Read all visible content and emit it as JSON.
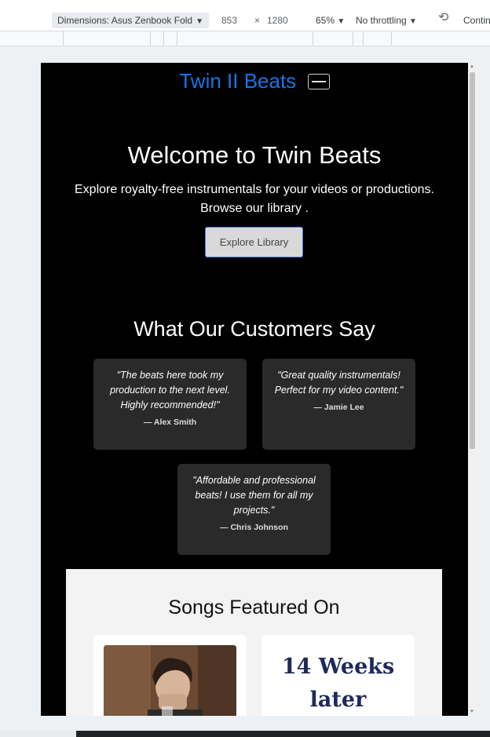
{
  "devtools": {
    "device_label": "Dimensions: Asus Zenbook Fold",
    "width": "853",
    "times": "×",
    "height": "1280",
    "zoom": "65%",
    "throttling": "No throttling",
    "continue_label": "Contin"
  },
  "site": {
    "brand": "Twin II Beats",
    "hero": {
      "title": "Welcome to Twin Beats",
      "subtitle": "Explore royalty-free instrumentals for your videos or productions. Browse our library .",
      "button": "Explore Library"
    },
    "testimonials": {
      "heading": "What Our Customers Say",
      "items": [
        {
          "quote": "\"The beats here took my production to the next level. Highly recommended!\"",
          "author": "— Alex Smith"
        },
        {
          "quote": "\"Great quality instrumentals! Perfect for my video content.\"",
          "author": "— Jamie Lee"
        },
        {
          "quote": "\"Affordable and professional beats! I use them for all my projects.\"",
          "author": "— Chris Johnson"
        }
      ]
    },
    "featured": {
      "heading": "Songs Featured On",
      "album_text": "14 Weeks later"
    }
  },
  "colors": {
    "brand": "#1a73e8",
    "page_bg": "#000000",
    "card_bg": "#2a2a2a",
    "featured_bg": "#f3f3f3"
  }
}
